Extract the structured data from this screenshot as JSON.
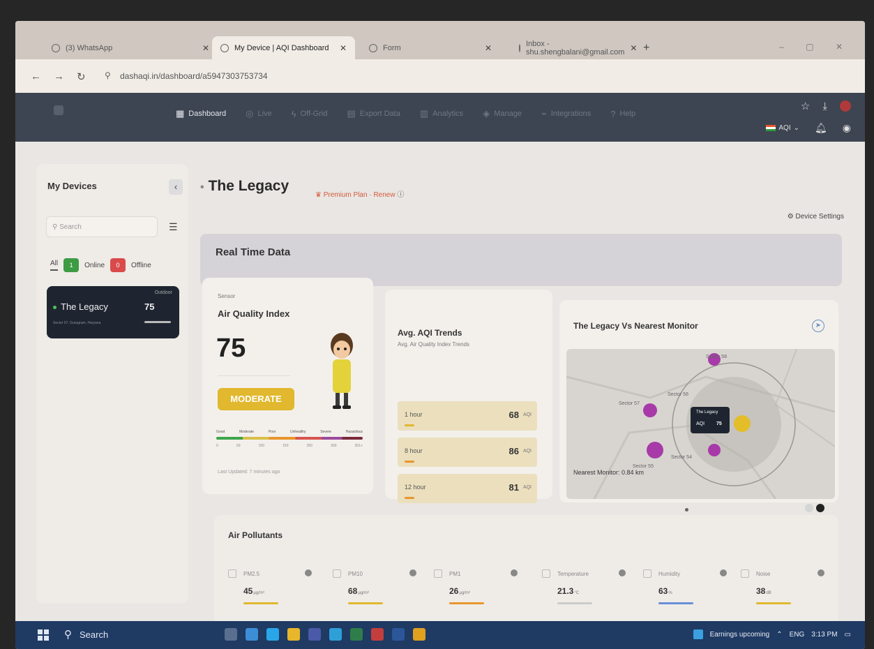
{
  "browser": {
    "tabs": [
      {
        "title": "(3) WhatsApp",
        "active": false
      },
      {
        "title": "My Device | AQI Dashboard",
        "active": true
      },
      {
        "title": "Form",
        "active": false
      },
      {
        "title": "Inbox - shu.shengbalani@gmail.com",
        "active": false
      }
    ],
    "url": "dashaqi.in/dashboard/a5947303753734"
  },
  "header": {
    "nav": [
      {
        "label": "Dashboard",
        "icon": "grid-icon",
        "active": true
      },
      {
        "label": "Live",
        "icon": "live-icon",
        "active": false
      },
      {
        "label": "Off-Grid",
        "icon": "bolt-icon",
        "active": false
      },
      {
        "label": "Export Data",
        "icon": "document-icon",
        "active": false
      },
      {
        "label": "Analytics",
        "icon": "chart-icon",
        "active": false
      },
      {
        "label": "Manage",
        "icon": "manage-icon",
        "active": false
      },
      {
        "label": "Integrations",
        "icon": "plug-icon",
        "active": false
      },
      {
        "label": "Help",
        "icon": "help-icon",
        "active": false
      }
    ],
    "aqi_label": "AQI",
    "aqi_standard": "IN Standard"
  },
  "sidebar": {
    "title": "My Devices",
    "search_placeholder": "Search",
    "filters": {
      "all": "All",
      "online_count": "1",
      "online": "Online",
      "offline_count": "0",
      "offline": "Offline"
    },
    "devices": [
      {
        "name": "The Legacy",
        "aqi": "75",
        "status": "Outdoor",
        "location": "Sector 57, Gurugram, Haryana"
      }
    ]
  },
  "main": {
    "title": "The Legacy",
    "plan": "Premium Plan",
    "renew": "Renew",
    "device_settings": "Device Settings",
    "section_title": "Real Time Data"
  },
  "aqi_card": {
    "sensor": "Sensor",
    "title": "Air Quality Index",
    "value": "75",
    "category": "MODERATE",
    "scale_labels": [
      "Good",
      "Moderate",
      "Poor",
      "Unhealthy",
      "Severe",
      "Hazardous"
    ],
    "scale_ticks": [
      "0",
      "50",
      "100",
      "150",
      "200",
      "300",
      "301+"
    ],
    "last_updated": "Last Updated: 7 minutes ago"
  },
  "trends": {
    "title": "Avg. AQI Trends",
    "subtitle": "Avg. Air Quality Index Trends",
    "unit": "AQI",
    "rows": [
      {
        "label": "1 hour",
        "value": "68"
      },
      {
        "label": "8 hour",
        "value": "86"
      },
      {
        "label": "12 hour",
        "value": "81"
      }
    ]
  },
  "map_card": {
    "title": "The Legacy Vs Nearest Monitor",
    "nearest": "Nearest Monitor: 0.84 km",
    "popup_name": "The Legacy",
    "popup_aqi_label": "AQI",
    "popup_aqi": "75",
    "place_labels": [
      "Sector 58",
      "Sector 57",
      "Sector 56",
      "Sector 55",
      "Sector 54"
    ]
  },
  "pollutants": {
    "title": "Air Pollutants",
    "items": [
      {
        "name": "PM2.5",
        "value": "45",
        "unit": "µg/m³",
        "color": "#e1b82e"
      },
      {
        "name": "PM10",
        "value": "68",
        "unit": "µg/m³",
        "color": "#e1b82e"
      },
      {
        "name": "PM1",
        "value": "26",
        "unit": "µg/m³",
        "color": "#e8962e"
      },
      {
        "name": "Temperature",
        "value": "21.3",
        "unit": "°C",
        "color": "#cccccc"
      },
      {
        "name": "Humidity",
        "value": "63",
        "unit": "%",
        "color": "#6a8fd8"
      },
      {
        "name": "Noise",
        "value": "38",
        "unit": "dB",
        "color": "#e1b82e"
      }
    ]
  },
  "taskbar": {
    "search": "Search",
    "news": "Earnings upcoming",
    "lang": "ENG",
    "time": "3:13 PM"
  }
}
